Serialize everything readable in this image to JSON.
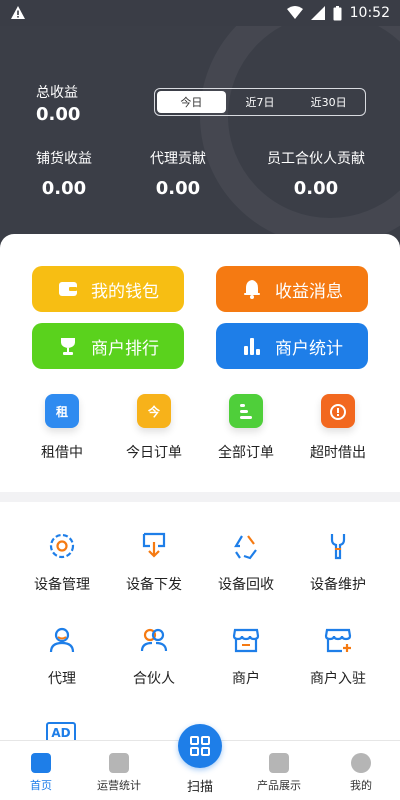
{
  "status": {
    "time": "10:52"
  },
  "header": {
    "total_label": "总收益",
    "total_value": "0.00",
    "tabs": [
      "今日",
      "近7日",
      "近30日"
    ],
    "stats": [
      {
        "label": "铺货收益",
        "value": "0.00"
      },
      {
        "label": "代理贡献",
        "value": "0.00"
      },
      {
        "label": "员工合伙人贡献",
        "value": "0.00"
      }
    ]
  },
  "actions": {
    "wallet": "我的钱包",
    "income_msg": "收益消息",
    "ranking": "商户排行",
    "merchant_stats": "商户统计"
  },
  "quick": [
    {
      "label": "租借中",
      "icon_text": "租"
    },
    {
      "label": "今日订单",
      "icon_text": "今"
    },
    {
      "label": "全部订单",
      "icon_text": ""
    },
    {
      "label": "超时借出",
      "icon_text": ""
    }
  ],
  "grid": [
    "设备管理",
    "设备下发",
    "设备回收",
    "设备维护",
    "代理",
    "合伙人",
    "商户",
    "商户入驻"
  ],
  "ad_text": "AD",
  "nav": {
    "home": "首页",
    "ops": "运营统计",
    "scan": "扫描",
    "products": "产品展示",
    "mine": "我的"
  },
  "colors": {
    "primary": "#1e7ee8",
    "yellow": "#f7be13",
    "orange": "#f57a12",
    "green": "#5ad21d",
    "header_bg": "#3b3e47"
  }
}
